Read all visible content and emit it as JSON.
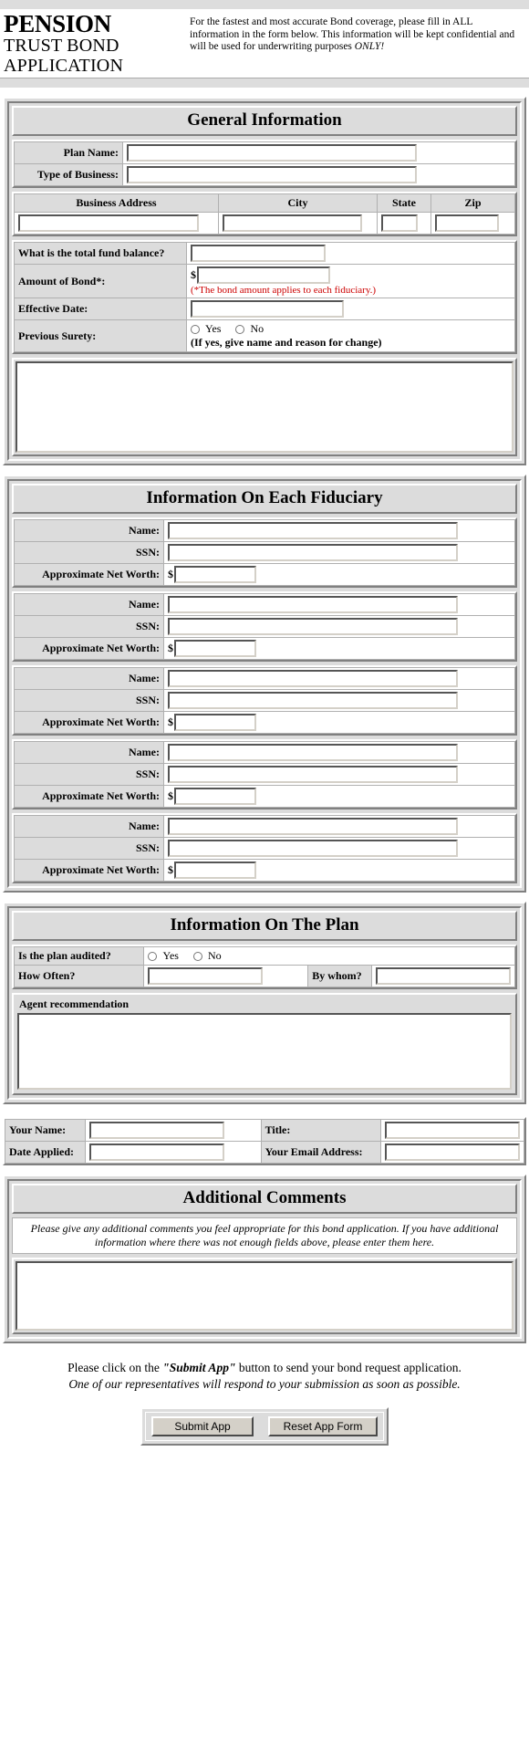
{
  "header": {
    "title_line1": "PENSION",
    "title_line2": "TRUST BOND",
    "title_line3": "APPLICATION",
    "blurb_part1": "For the fastest and most accurate Bond coverage, please fill in ALL information in the form below. This information will be kept confidential and will be used for underwriting purposes ",
    "blurb_emphasis": "ONLY!"
  },
  "general": {
    "section_title": "General Information",
    "plan_name_label": "Plan Name:",
    "plan_name_value": "",
    "type_of_business_label": "Type of Business:",
    "type_of_business_value": "",
    "address_headers": {
      "street": "Business Address",
      "city": "City",
      "state": "State",
      "zip": "Zip"
    },
    "address_values": {
      "street": "",
      "city": "",
      "state": "",
      "zip": ""
    },
    "fund_balance_label": "What is the total fund balance?",
    "fund_balance_value": "",
    "bond_amount_label": "Amount of Bond*:",
    "bond_amount_currency": "$",
    "bond_amount_value": "",
    "bond_amount_note": "(*The bond amount applies to each fiduciary.)",
    "effective_date_label": "Effective Date:",
    "effective_date_value": "",
    "previous_surety_label": "Previous Surety:",
    "previous_surety_yes": "Yes",
    "previous_surety_no": "No",
    "previous_surety_hint": "(If yes, give name and reason for change)",
    "surety_details_value": ""
  },
  "fiduciary": {
    "section_title": "Information On Each Fiduciary",
    "name_label": "Name:",
    "ssn_label": "SSN:",
    "net_worth_label": "Approximate Net Worth:",
    "currency": "$",
    "entries": [
      {
        "name": "",
        "ssn": "",
        "net_worth": ""
      },
      {
        "name": "",
        "ssn": "",
        "net_worth": ""
      },
      {
        "name": "",
        "ssn": "",
        "net_worth": ""
      },
      {
        "name": "",
        "ssn": "",
        "net_worth": ""
      },
      {
        "name": "",
        "ssn": "",
        "net_worth": ""
      }
    ]
  },
  "plan": {
    "section_title": "Information On The Plan",
    "audited_label": "Is the plan audited?",
    "audited_yes": "Yes",
    "audited_no": "No",
    "how_often_label": "How Often?",
    "how_often_value": "",
    "by_whom_label": "By whom?",
    "by_whom_value": "",
    "agent_recommendation_legend": "Agent recommendation",
    "agent_recommendation_value": ""
  },
  "applicant": {
    "your_name_label": "Your Name:",
    "your_name_value": "",
    "title_label": "Title:",
    "title_value": "",
    "date_applied_label": "Date Applied:",
    "date_applied_value": "",
    "email_label": "Your Email Address:",
    "email_value": ""
  },
  "comments": {
    "section_title": "Additional Comments",
    "note": "Please give any additional comments you feel appropriate for this bond application. If you have additional information where there was not enough fields above, please enter them here.",
    "value": ""
  },
  "footer": {
    "line1_before": "Please click on the ",
    "line1_button": "\"Submit App\"",
    "line1_after": " button to send your bond request application.",
    "line2": "One of our representatives will respond to your submission as soon as possible.",
    "submit_label": "Submit App",
    "reset_label": "Reset App Form"
  },
  "colors": {
    "note_red": "#cc0000",
    "panel_gray": "#dcdcdc",
    "strip_gray": "#dddddd",
    "button_face": "#d4d0c8"
  }
}
